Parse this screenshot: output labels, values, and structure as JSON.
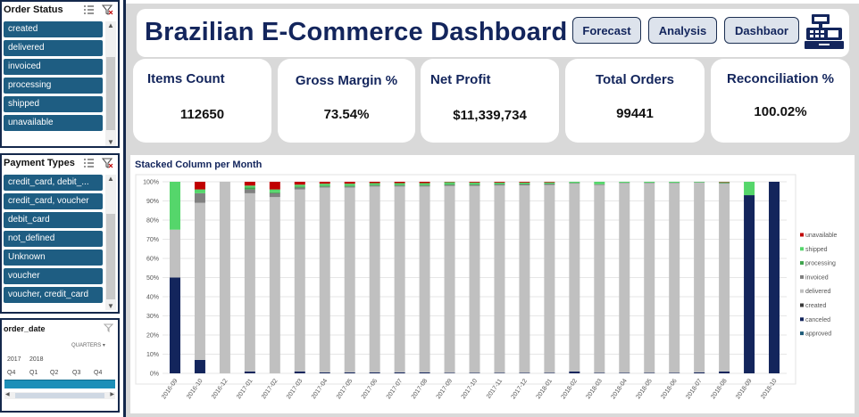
{
  "order_status": {
    "title": "Order Status",
    "items": [
      "created",
      "delivered",
      "invoiced",
      "processing",
      "shipped",
      "unavailable"
    ]
  },
  "payment_types": {
    "title": "Payment Types",
    "items": [
      "credit_card, debit_...",
      "credit_card, voucher",
      "debit_card",
      "not_defined",
      "Unknown",
      "voucher",
      "voucher, credit_card"
    ]
  },
  "timeline": {
    "title": "order_date",
    "period": "QUARTERS",
    "years": [
      "2017",
      "2018"
    ],
    "quarters": [
      "Q4",
      "Q1",
      "Q2",
      "Q3",
      "Q4"
    ]
  },
  "header": {
    "title": "Brazilian E-Commerce Dashboard",
    "buttons": [
      "Forecast",
      "Analysis",
      "Dashbaor"
    ],
    "register_icon": "cash-register-icon"
  },
  "kpis": [
    {
      "label": "Items Count",
      "value": "112650"
    },
    {
      "label": "Gross Margin %",
      "value": "73.54%"
    },
    {
      "label": "Net Profit",
      "value": "$11,339,734"
    },
    {
      "label": "Total Orders",
      "value": "99441"
    },
    {
      "label": "Reconciliation %",
      "value": "100.02%"
    }
  ],
  "colors": {
    "navy": "#13255c",
    "slicer_item": "#1e5d82",
    "approved": "#1f5c7a",
    "canceled": "#13255c",
    "created": "#3a3a3a",
    "delivered": "#c0c0c0",
    "invoiced": "#808080",
    "processing": "#3fa34d",
    "shipped": "#55d66b",
    "unavailable": "#c00000"
  },
  "chart_data": {
    "type": "bar",
    "stacked": true,
    "title": "Stacked Column per Month",
    "categories": [
      "2016-09",
      "2016-10",
      "2016-12",
      "2017-01",
      "2017-02",
      "2017-03",
      "2017-04",
      "2017-05",
      "2017-06",
      "2017-07",
      "2017-08",
      "2017-09",
      "2017-10",
      "2017-11",
      "2017-12",
      "2018-01",
      "2018-02",
      "2018-03",
      "2018-04",
      "2018-05",
      "2018-06",
      "2018-07",
      "2018-08",
      "2018-09",
      "2018-10"
    ],
    "ylim": [
      0,
      100
    ],
    "yticks": [
      "0%",
      "10%",
      "20%",
      "30%",
      "40%",
      "50%",
      "60%",
      "70%",
      "80%",
      "90%",
      "100%"
    ],
    "legend_position": "right",
    "grid": true,
    "series": [
      {
        "name": "approved",
        "values": [
          0,
          0,
          0,
          0,
          0,
          0,
          0,
          0,
          0,
          0,
          0,
          0,
          0,
          0,
          0,
          0,
          0,
          0,
          0,
          0,
          0,
          0,
          0,
          0,
          0
        ]
      },
      {
        "name": "canceled",
        "values": [
          50,
          7,
          0,
          1,
          0,
          1,
          0.5,
          0.5,
          0.5,
          0.5,
          0.5,
          0.3,
          0.3,
          0.3,
          0.3,
          0.3,
          1,
          0.3,
          0.3,
          0.3,
          0.3,
          0.5,
          1,
          93,
          100
        ]
      },
      {
        "name": "created",
        "values": [
          0,
          0,
          0,
          0,
          0,
          0,
          0,
          0,
          0,
          0,
          0,
          0,
          0,
          0,
          0,
          0,
          0,
          0,
          0,
          0,
          0,
          0,
          0,
          0,
          0
        ]
      },
      {
        "name": "delivered",
        "values": [
          25,
          82,
          100,
          93,
          92,
          95,
          96.5,
          96.5,
          97,
          97,
          97,
          97.5,
          97.5,
          97.7,
          97.8,
          98,
          98,
          98,
          99,
          99,
          99,
          99,
          98,
          0,
          0
        ]
      },
      {
        "name": "invoiced",
        "values": [
          0,
          5,
          0,
          2,
          2,
          1,
          0.5,
          0.5,
          0.5,
          0.5,
          0.5,
          0.5,
          0.5,
          0.5,
          0.5,
          0.5,
          0.3,
          0.3,
          0.2,
          0.2,
          0.2,
          0.2,
          0.3,
          0,
          0
        ]
      },
      {
        "name": "processing",
        "values": [
          0,
          0,
          0,
          1,
          0.5,
          0.5,
          0.5,
          0.5,
          0.5,
          0.5,
          0.5,
          0.5,
          0.5,
          0.5,
          0.4,
          0.3,
          0.1,
          0.1,
          0,
          0,
          0,
          0,
          0,
          0,
          0
        ]
      },
      {
        "name": "shipped",
        "values": [
          25,
          2,
          0,
          1,
          1.5,
          1,
          1,
          1,
          0.8,
          0.8,
          0.8,
          1,
          0.8,
          0.6,
          0.6,
          0.6,
          0.6,
          1.3,
          0.5,
          0.5,
          0.5,
          0.3,
          0.5,
          7,
          0
        ]
      },
      {
        "name": "unavailable",
        "values": [
          0,
          4,
          0,
          2,
          4,
          1.5,
          1,
          1,
          0.7,
          0.7,
          0.7,
          0.2,
          0.4,
          0.4,
          0.4,
          0.3,
          0,
          0,
          0,
          0,
          0,
          0,
          0.2,
          0,
          0
        ]
      }
    ]
  }
}
